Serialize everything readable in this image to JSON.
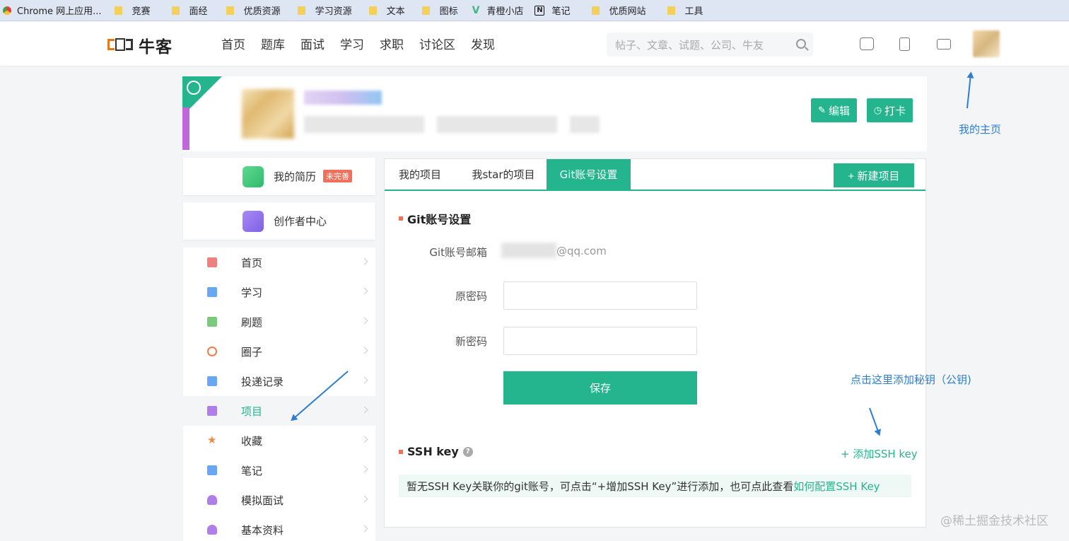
{
  "bookmarks": [
    {
      "label": "Chrome 网上应用..."
    },
    {
      "label": "竞赛"
    },
    {
      "label": "面经"
    },
    {
      "label": "优质资源"
    },
    {
      "label": "学习资源"
    },
    {
      "label": "文本"
    },
    {
      "label": "图标"
    },
    {
      "label": "青橙小店"
    },
    {
      "label": "笔记"
    },
    {
      "label": "优质网站"
    },
    {
      "label": "工具"
    }
  ],
  "header": {
    "logo": "牛客",
    "nav": [
      "首页",
      "题库",
      "面试",
      "学习",
      "求职",
      "讨论区",
      "发现"
    ],
    "search_placeholder": "帖子、文章、试题、公司、牛友"
  },
  "profile": {
    "edit_label": "编辑",
    "checkin_label": "打卡"
  },
  "sidebar": {
    "resume_label": "我的简历",
    "resume_badge": "未完善",
    "creator_label": "创作者中心",
    "items": [
      {
        "label": "首页",
        "icon": "home-icon",
        "color": "#f07f7f"
      },
      {
        "label": "学习",
        "icon": "document-icon",
        "color": "#6aa7f2"
      },
      {
        "label": "刷题",
        "icon": "graduation-cap-icon",
        "color": "#7bc97d"
      },
      {
        "label": "圈子",
        "icon": "target-icon",
        "color": "#ef7b4e"
      },
      {
        "label": "投递记录",
        "icon": "folder-icon",
        "color": "#6aa7f2"
      },
      {
        "label": "项目",
        "icon": "project-folder-icon",
        "color": "#b07ee8"
      },
      {
        "label": "收藏",
        "icon": "star-icon",
        "color": "#f08a3e"
      },
      {
        "label": "笔记",
        "icon": "notebook-icon",
        "color": "#6aa7f2"
      },
      {
        "label": "模拟面试",
        "icon": "user-icon",
        "color": "#b07ee8"
      },
      {
        "label": "基本资料",
        "icon": "user-icon",
        "color": "#b07ee8"
      }
    ]
  },
  "main": {
    "tabs": [
      "我的项目",
      "我star的项目",
      "Git账号设置"
    ],
    "active_tab": "Git账号设置",
    "new_project_label": "+ 新建项目",
    "git_section_title": "Git账号设置",
    "email_label": "Git账号邮箱",
    "email_suffix": "@qq.com",
    "old_password_label": "原密码",
    "new_password_label": "新密码",
    "save_label": "保存",
    "ssh_section_title": "SSH key",
    "add_ssh_label": "+ 添加SSH key",
    "ssh_note": "暂无SSH Key关联你的git账号，可点击“+增加SSH Key”进行添加，也可点此查看",
    "ssh_note_link": "如何配置SSH Key"
  },
  "annotations": {
    "homepage": "我的主页",
    "add_key": "点击这里添加秘钥（公钥)"
  },
  "watermark": "@稀土掘金技术社区",
  "colors": {
    "accent": "#25b58e",
    "annotation": "#2d7ed3",
    "badge": "#f0715b"
  }
}
